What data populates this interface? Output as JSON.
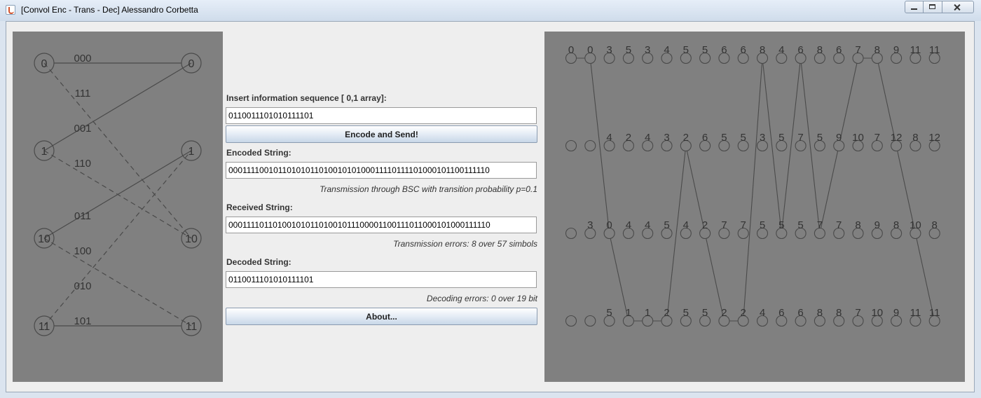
{
  "window": {
    "title": "[Convol Enc - Trans - Dec] Alessandro Corbetta",
    "icon": "java-cup-icon"
  },
  "form": {
    "info_label": "Insert information sequence [ 0,1 array]:",
    "info_value": "0110011101010111101",
    "encode_button": "Encode and Send!",
    "encoded_label": "Encoded String:",
    "encoded_value": "0001111001011010101101001010100011110111101000101100111110",
    "transmission_note": "Transmission through BSC with transition probability p=0.1",
    "received_label": "Received String:",
    "received_value": "0001111011010010101101001011100001100111011000101000111110",
    "transmission_errors": "Transmission errors: 8 over 57 simbols",
    "decoded_label": "Decoded String:",
    "decoded_value": "0110011101010111101",
    "decoding_errors": "Decoding errors: 0 over 19 bit",
    "about_button": "About..."
  },
  "state_diagram": {
    "left_states": [
      "0",
      "1",
      "10",
      "11"
    ],
    "right_states": [
      "0",
      "1",
      "10",
      "11"
    ],
    "edges": [
      {
        "from": 0,
        "to": 0,
        "label": "000",
        "style": "solid"
      },
      {
        "from": 0,
        "to": 2,
        "label": "111",
        "style": "dashed"
      },
      {
        "from": 1,
        "to": 0,
        "label": "001",
        "style": "solid"
      },
      {
        "from": 1,
        "to": 2,
        "label": "110",
        "style": "dashed"
      },
      {
        "from": 2,
        "to": 1,
        "label": "011",
        "style": "solid"
      },
      {
        "from": 2,
        "to": 3,
        "label": "100",
        "style": "dashed"
      },
      {
        "from": 3,
        "to": 1,
        "label": "010",
        "style": "dashed"
      },
      {
        "from": 3,
        "to": 3,
        "label": "101",
        "style": "solid"
      }
    ]
  },
  "trellis": {
    "rows": [
      [
        "0",
        "0",
        "3",
        "5",
        "3",
        "4",
        "5",
        "5",
        "6",
        "6",
        "8",
        "4",
        "6",
        "8",
        "6",
        "7",
        "8",
        "9",
        "11",
        "11"
      ],
      [
        "",
        "",
        "4",
        "2",
        "4",
        "3",
        "2",
        "6",
        "5",
        "5",
        "3",
        "5",
        "7",
        "5",
        "9",
        "10",
        "7",
        "12",
        "8",
        "12"
      ],
      [
        "",
        "3",
        "0",
        "4",
        "4",
        "5",
        "4",
        "2",
        "7",
        "7",
        "5",
        "5",
        "5",
        "7",
        "7",
        "8",
        "9",
        "8",
        "10",
        "8"
      ],
      [
        "",
        "",
        "5",
        "1",
        "1",
        "2",
        "5",
        "5",
        "2",
        "2",
        "4",
        "6",
        "6",
        "8",
        "8",
        "7",
        "10",
        "9",
        "11",
        "11"
      ]
    ],
    "path_states": [
      0,
      0,
      2,
      3,
      3,
      3,
      1,
      2,
      3,
      3,
      0,
      2,
      0,
      2,
      1,
      0,
      0,
      1,
      2,
      3
    ]
  },
  "colors": {
    "panel_bg": "#808080",
    "stroke": "#4a4a4a",
    "label": "#333333"
  }
}
